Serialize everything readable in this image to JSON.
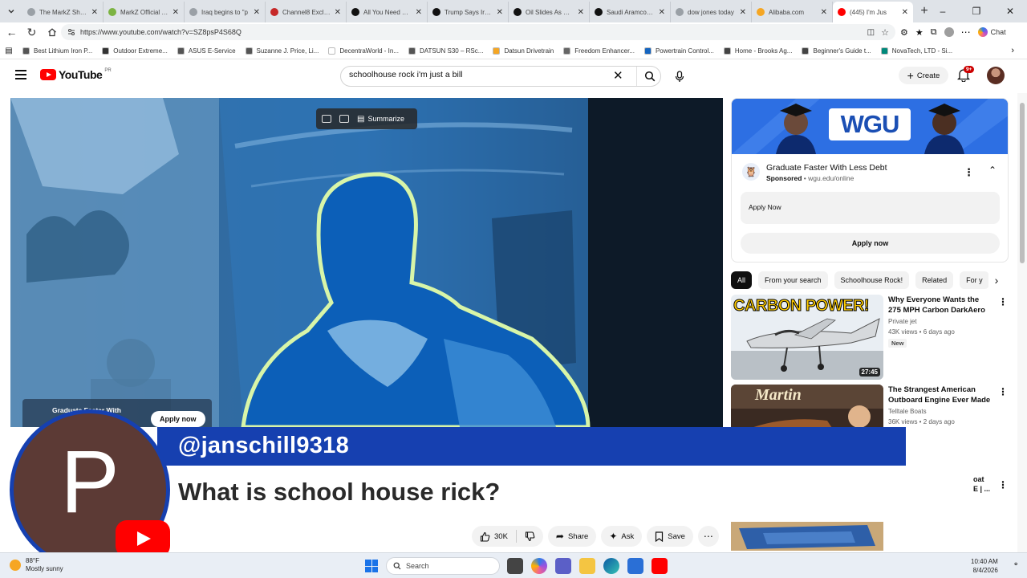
{
  "browser": {
    "tabs": [
      {
        "label": "The MarkZ Show",
        "color": "#9aa0a6"
      },
      {
        "label": "MarkZ Official Te",
        "color": "#7cb342"
      },
      {
        "label": "Iraq begins to \"p",
        "color": "#9aa0a6"
      },
      {
        "label": "Channel8 Exclusiv",
        "color": "#c62828"
      },
      {
        "label": "All You Need To K",
        "color": "#111111"
      },
      {
        "label": "Trump Says Iran N",
        "color": "#111111"
      },
      {
        "label": "Oil Slides As Qata",
        "color": "#111111"
      },
      {
        "label": "Saudi Aramco Pri",
        "color": "#111111"
      },
      {
        "label": "dow jones today",
        "color": "#9aa0a6"
      },
      {
        "label": "Alibaba.com",
        "color": "#f5a623"
      },
      {
        "label": "(445) I'm Jus",
        "color": "#ff0000",
        "active": true
      }
    ],
    "url": "https://www.youtube.com/watch?v=SZ8psP4S68Q",
    "chat_label": "Chat",
    "bookmarks": [
      {
        "label": "Best Lithium Iron P...",
        "color": "#555555"
      },
      {
        "label": "Outdoor Extreme...",
        "color": "#333333"
      },
      {
        "label": "ASUS E-Service",
        "color": "#555555"
      },
      {
        "label": "Suzanne J. Price, Li...",
        "color": "#555555"
      },
      {
        "label": "DecentraWorld - In...",
        "color": "#ffffff"
      },
      {
        "label": "DATSUN S30 – RSc...",
        "color": "#555555"
      },
      {
        "label": "Datsun Drivetrain",
        "color": "#f5a623"
      },
      {
        "label": "Freedom Enhancer...",
        "color": "#666666"
      },
      {
        "label": "Powertrain Control...",
        "color": "#1565c0"
      },
      {
        "label": "Home - Brooks Ag...",
        "color": "#444444"
      },
      {
        "label": "Beginner's Guide t...",
        "color": "#444444"
      },
      {
        "label": "NovaTech, LTD - Si...",
        "color": "#00897b"
      }
    ]
  },
  "youtube": {
    "logo_text": "YouTube",
    "logo_region": "PR",
    "search_value": "schoolhouse rock i'm just a bill",
    "create_label": "Create",
    "notif_count": "9+"
  },
  "player": {
    "summarize_label": "Summarize",
    "overlay_ad_text": "Graduate Faster With",
    "overlay_ad_button": "Apply now"
  },
  "overlay": {
    "handle": "@janschill9318",
    "question": "What is school house rick?",
    "avatar_letter": "P"
  },
  "actions": {
    "like_count": "30K",
    "share": "Share",
    "ask": "Ask",
    "save": "Save"
  },
  "ad": {
    "brand": "WGU",
    "title": "Graduate Faster With Less Debt",
    "sponsored": "Sponsored",
    "domain": "wgu.edu/online",
    "apply_box": "Apply Now",
    "apply_button": "Apply now"
  },
  "chips": [
    "All",
    "From your search",
    "Schoolhouse Rock!",
    "Related",
    "For y"
  ],
  "related": [
    {
      "title": "Why Everyone Wants the 275 MPH Carbon DarkAero",
      "channel": "Private jet",
      "meta": "43K views • 6 days ago",
      "badge": "New",
      "duration": "27:45",
      "thumb_text": "CARBON POWER!"
    },
    {
      "title": "The Strangest American Outboard Engine Ever Made",
      "channel": "Telltale Boats",
      "meta": "36K views • 2 days ago",
      "thumb_text": "Martin"
    }
  ],
  "partial_title": "oat\nE | ...",
  "taskbar": {
    "temp": "88°F",
    "weather": "Mostly sunny",
    "search": "Search",
    "time": "10:40 AM",
    "date": "8/4/2026"
  }
}
